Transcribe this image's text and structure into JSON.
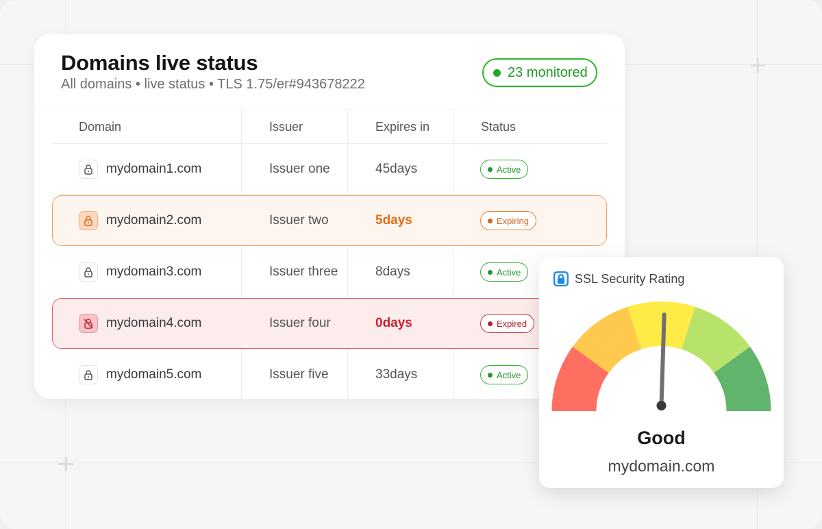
{
  "panel": {
    "title": "Domains live status",
    "subtitle": "All domains • live status • TLS 1.75/er#943678222",
    "monitored_label": "23 monitored"
  },
  "table": {
    "columns": [
      "Domain",
      "Issuer",
      "Expires in",
      "Status"
    ],
    "rows": [
      {
        "domain": "mydomain1.com",
        "issuer": "Issuer one",
        "expires": "45days",
        "status": "Active",
        "state": "active"
      },
      {
        "domain": "mydomain2.com",
        "issuer": "Issuer two",
        "expires": "5days",
        "status": "Expiring",
        "state": "expiring"
      },
      {
        "domain": "mydomain3.com",
        "issuer": "Issuer three",
        "expires": "8days",
        "status": "Active",
        "state": "active"
      },
      {
        "domain": "mydomain4.com",
        "issuer": "Issuer four",
        "expires": "0days",
        "status": "Expired",
        "state": "expired"
      },
      {
        "domain": "mydomain5.com",
        "issuer": "Issuer five",
        "expires": "33days",
        "status": "Active",
        "state": "active"
      }
    ]
  },
  "rating": {
    "title": "SSL Security Rating",
    "grade": "Good",
    "domain": "mydomain.com",
    "gauge_level": 0.51,
    "segment_colors": [
      "#ff6f61",
      "#ffc94d",
      "#ffeb45",
      "#b8e36a",
      "#61b46b"
    ]
  },
  "colors": {
    "accent_green": "#23982a",
    "warning_orange": "#e46f17",
    "error_red": "#cc1f2f"
  }
}
